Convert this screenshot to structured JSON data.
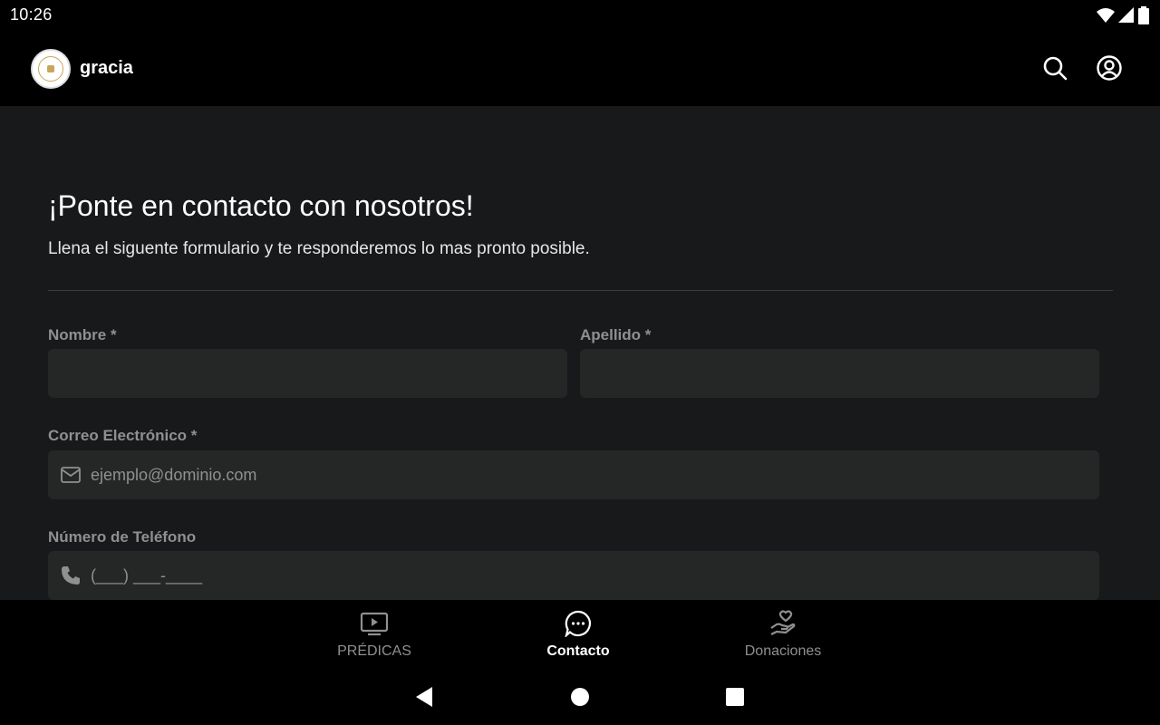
{
  "status_bar": {
    "time": "10:26"
  },
  "app_bar": {
    "title": "gracia"
  },
  "form": {
    "heading": "¡Ponte en contacto con nosotros!",
    "subheading": "Llena el siguente formulario y te responderemos lo mas pronto posible.",
    "first_name": {
      "label": "Nombre *",
      "value": "",
      "placeholder": ""
    },
    "last_name": {
      "label": "Apellido *",
      "value": "",
      "placeholder": ""
    },
    "email": {
      "label": "Correo Electrónico *",
      "value": "",
      "placeholder": "ejemplo@dominio.com"
    },
    "phone": {
      "label": "Número de Teléfono",
      "value": "",
      "placeholder": "(___) ___-____"
    }
  },
  "bottom_nav": {
    "items": [
      {
        "label": "PRÉDICAS",
        "icon": "tv-play-icon",
        "active": false
      },
      {
        "label": "Contacto",
        "icon": "chat-bubble-icon",
        "active": true
      },
      {
        "label": "Donaciones",
        "icon": "hand-heart-icon",
        "active": false
      }
    ]
  },
  "colors": {
    "background": "#17191a",
    "bar": "#000000",
    "field": "#252727",
    "label": "#8e9091",
    "text": "#ffffff"
  }
}
